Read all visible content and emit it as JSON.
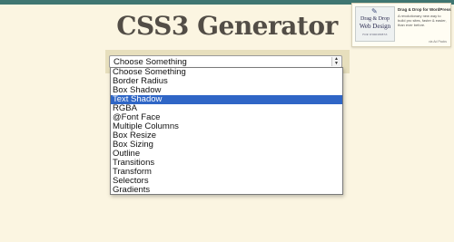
{
  "colors": {
    "background": "#fbf5e1",
    "top_bar": "#3f7671",
    "title": "#524d46",
    "selection_highlight": "#2f66c6"
  },
  "header": {
    "title": "CSS3 Generator"
  },
  "ad": {
    "thumb_icon": "pencil-icon",
    "thumb_line1": "Drag & Drop",
    "thumb_line2": "Web Design",
    "thumb_line3": "FOR WORDPRESS",
    "title": "Drag & Drop for WordPress",
    "description": "A revolutionary new way to build pro sites, faster & easier, than ever before.",
    "via": "via Ad Packs"
  },
  "select": {
    "current_value": "Choose Something",
    "options": [
      "Choose Something",
      "Border Radius",
      "Box Shadow",
      "Text Shadow",
      "RGBA",
      "@Font Face",
      "Multiple Columns",
      "Box Resize",
      "Box Sizing",
      "Outline",
      "Transitions",
      "Transform",
      "Selectors",
      "Gradients"
    ],
    "highlighted_option": "Text Shadow"
  }
}
